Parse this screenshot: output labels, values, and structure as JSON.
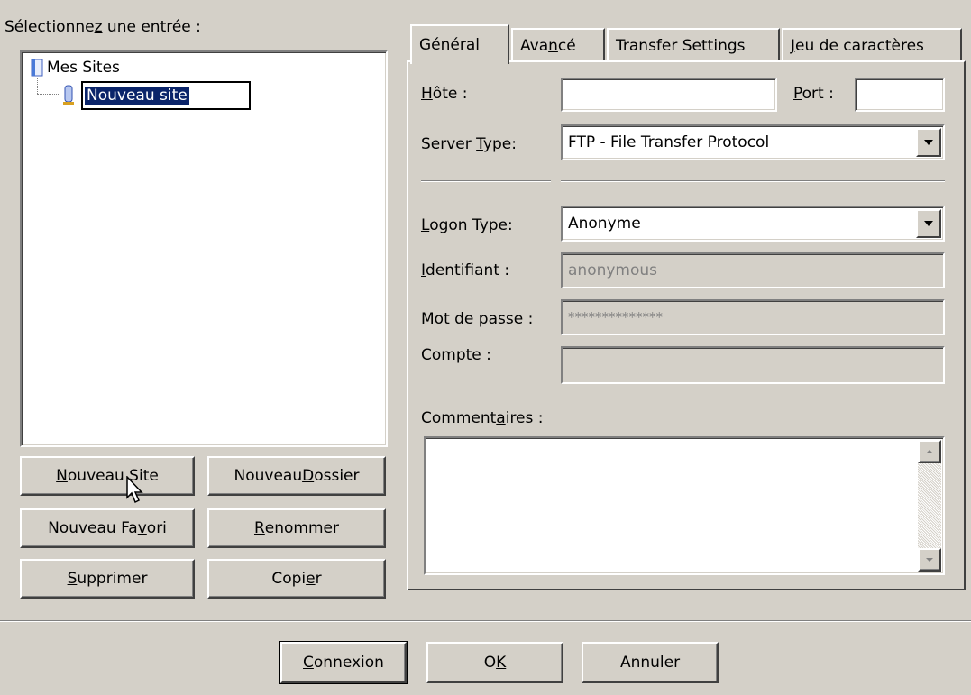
{
  "tree": {
    "select_label": "Sélectionnez une entrée :",
    "root": "Mes Sites",
    "child_edit": "Nouveau site"
  },
  "left_buttons": {
    "new_site": "Nouveau Site",
    "new_folder": "Nouveau Dossier",
    "new_favorite": "Nouveau Favori",
    "rename": "Renommer",
    "delete": "Supprimer",
    "copy": "Copier"
  },
  "tabs": [
    "Général",
    "Avancé",
    "Transfer Settings",
    "Jeu de caractères"
  ],
  "general": {
    "host_label": "Hôte :",
    "host_value": "",
    "port_label": "Port :",
    "port_value": "",
    "server_type_label": "Server Type:",
    "server_type_value": "FTP - File Transfer Protocol",
    "logon_type_label": "Logon Type:",
    "logon_type_value": "Anonyme",
    "user_label": "Identifiant :",
    "user_value": "anonymous",
    "password_label": "Mot de passe :",
    "password_value": "**************",
    "account_label": "Compte :",
    "account_value": "",
    "comments_label": "Commentaires :",
    "comments_value": ""
  },
  "bottom_buttons": {
    "connect": "Connexion",
    "ok": "OK",
    "cancel": "Annuler"
  },
  "icons": {
    "tree_root": "folder-blue-icon",
    "tree_child": "site-icon",
    "cursor": "mouse-pointer-icon"
  }
}
